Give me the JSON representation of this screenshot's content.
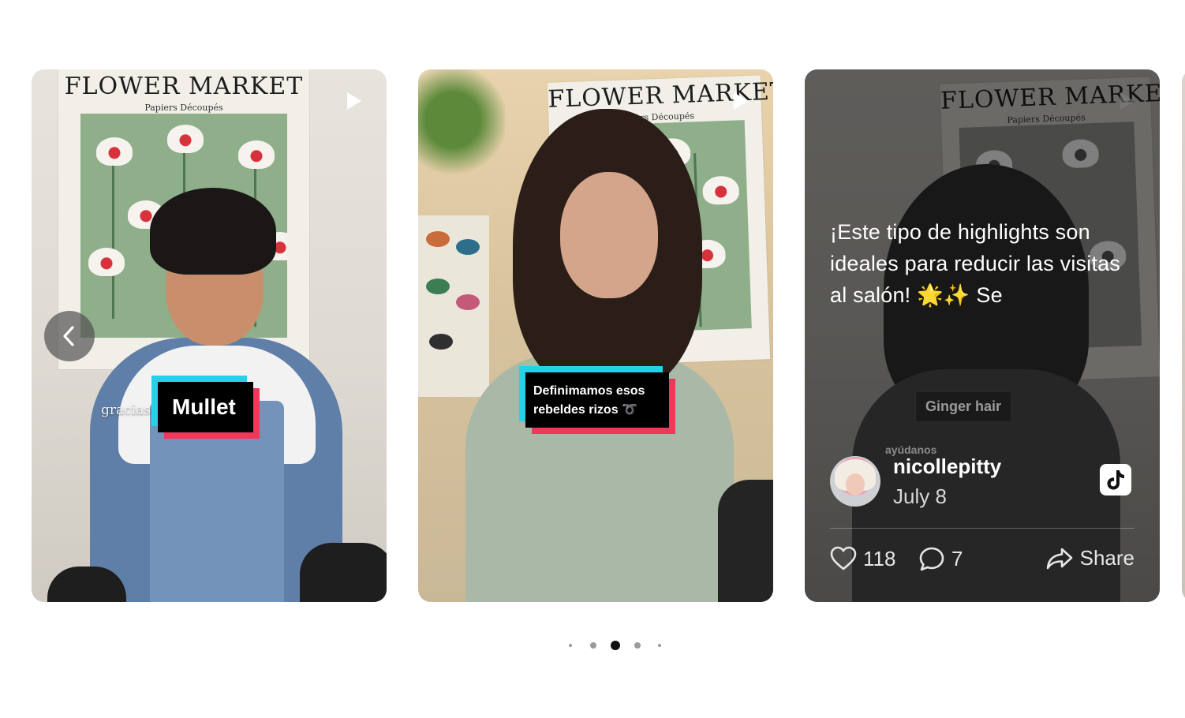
{
  "carousel": {
    "cards": [
      {
        "poster_title": "FLOWER MARKET",
        "poster_sub": "Papiers Découpés",
        "sticker_text": "Mullet",
        "overlay_text": "gracias"
      },
      {
        "poster_title": "FLOWER MARKET",
        "poster_sub": "Papiers Découpés",
        "sticker_text": "Definimamos esos rebeldes rizos ➰"
      },
      {
        "poster_title": "FLOWER MARKET",
        "poster_sub": "Papiers Découpés",
        "caption": "¡Este tipo de highlights son ideales para reducir las visitas al salón! 🌟✨ Se",
        "sticker_text": "Ginger hair",
        "overlay_text": "ayúdanos",
        "author": {
          "username": "nicollepitty",
          "date": "July 8"
        },
        "likes": "118",
        "comments": "7",
        "share_label": "Share"
      }
    ],
    "active_dot": 2,
    "dot_count": 5
  },
  "colors": {
    "sticker_cyan": "#25d1e6",
    "sticker_pink": "#f2375a",
    "dot_active": "#111111",
    "dot_inactive": "#9a9a9a"
  },
  "icons": [
    "play-icon",
    "chevron-left-icon",
    "heart-icon",
    "comment-icon",
    "share-icon",
    "tiktok-icon"
  ]
}
